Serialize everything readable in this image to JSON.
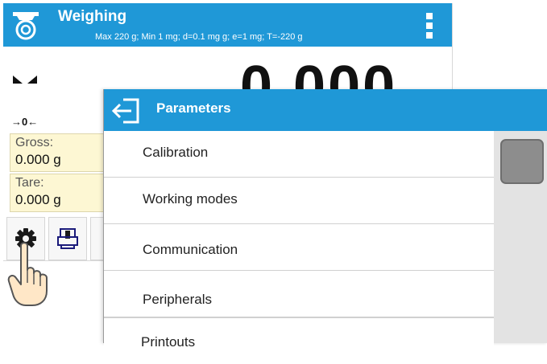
{
  "scale": {
    "title": "Weighing",
    "specs": "Max 220 g; Min 1 mg; d=0.1 mg g; e=1 mg; T=-220 g",
    "reading": "0.000",
    "zero_indicator": "→0←",
    "gross_label": "Gross:",
    "gross_value": "0.000 g",
    "tare_label": "Tare:",
    "tare_value": "0.000 g"
  },
  "parameters": {
    "title": "Parameters",
    "items": [
      {
        "label": "Calibration"
      },
      {
        "label": "Working modes"
      },
      {
        "label": "Communication"
      },
      {
        "label": "Peripherals"
      },
      {
        "label": "Printouts"
      }
    ]
  },
  "icons": {
    "mode": "weighing-mode-icon",
    "menu": "kebab-menu-icon",
    "back": "back-exit-icon",
    "settings": "gear-icon",
    "printout": "printer-icon",
    "cursor": "hand-pointer-icon",
    "stability": "stability-icon"
  },
  "colors": {
    "header_blue": "#1f98d7",
    "info_box_bg": "#fdf7d3",
    "scroll_track": "#e3e3e3",
    "scroll_thumb": "#8d8d8d"
  }
}
